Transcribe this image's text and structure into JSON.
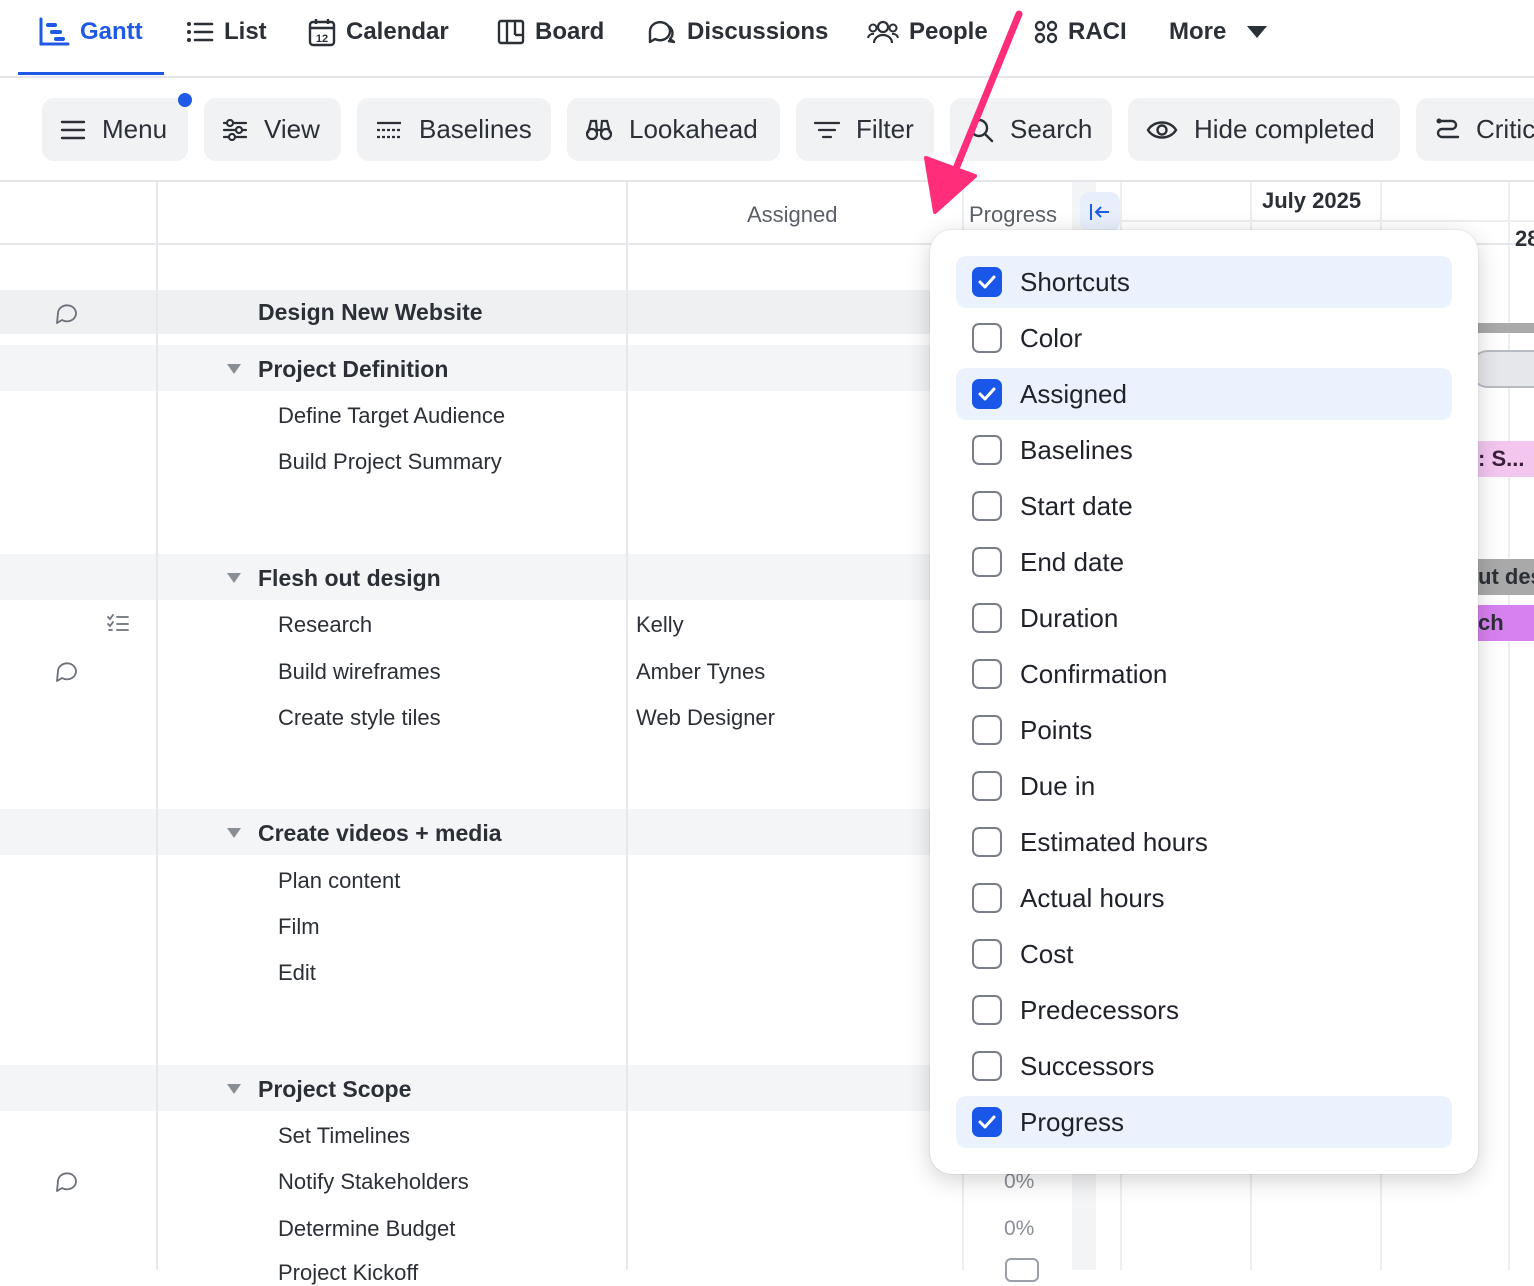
{
  "nav": {
    "tabs": [
      {
        "label": "Gantt",
        "icon": "gantt-icon",
        "active": true
      },
      {
        "label": "List",
        "icon": "list-icon"
      },
      {
        "label": "Calendar",
        "icon": "calendar-icon"
      },
      {
        "label": "Board",
        "icon": "board-icon"
      },
      {
        "label": "Discussions",
        "icon": "discussions-icon"
      },
      {
        "label": "People",
        "icon": "people-icon"
      },
      {
        "label": "RACI",
        "icon": "raci-icon"
      },
      {
        "label": "More",
        "icon": "chevron-down-icon"
      }
    ],
    "calendar_icon_day": "12",
    "accent": "#1f5ae6"
  },
  "toolbar": {
    "buttons": [
      {
        "label": "Menu",
        "icon": "menu-icon"
      },
      {
        "label": "View",
        "icon": "sliders-icon"
      },
      {
        "label": "Baselines",
        "icon": "baselines-icon"
      },
      {
        "label": "Lookahead",
        "icon": "binoculars-icon"
      },
      {
        "label": "Filter",
        "icon": "filter-icon"
      },
      {
        "label": "Search",
        "icon": "search-icon"
      },
      {
        "label": "Hide completed",
        "icon": "eye-icon"
      },
      {
        "label": "Critic",
        "icon": "critical-path-icon"
      }
    ]
  },
  "grid": {
    "headers": {
      "assigned": "Assigned",
      "progress": "Progress"
    },
    "project_title": "Design New Website",
    "groups": [
      {
        "title": "Project Definition",
        "tasks": [
          {
            "name": "Define Target Audience",
            "assigned": ""
          },
          {
            "name": "Build Project Summary",
            "assigned": ""
          }
        ]
      },
      {
        "title": "Flesh out design",
        "tasks": [
          {
            "name": "Research",
            "assigned": "Kelly"
          },
          {
            "name": "Build wireframes",
            "assigned": "Amber Tynes"
          },
          {
            "name": "Create style tiles",
            "assigned": "Web Designer"
          }
        ]
      },
      {
        "title": "Create videos + media",
        "tasks": [
          {
            "name": "Plan content",
            "assigned": ""
          },
          {
            "name": "Film",
            "assigned": ""
          },
          {
            "name": "Edit",
            "assigned": ""
          }
        ]
      },
      {
        "title": "Project Scope",
        "tasks": [
          {
            "name": "Set Timelines",
            "assigned": "",
            "progress": ""
          },
          {
            "name": "Notify Stakeholders",
            "assigned": "",
            "progress": "0%"
          },
          {
            "name": "Determine Budget",
            "assigned": "",
            "progress": "0%"
          },
          {
            "name": "Project Kickoff",
            "assigned": ""
          }
        ]
      }
    ]
  },
  "timeline": {
    "month": "July 2025",
    "day": "28",
    "bars": [
      {
        "text": ": S...",
        "color": "#f3c6f0",
        "text_color": "#3a1f3a"
      },
      {
        "text": "ut des",
        "color": "#a9a9a9",
        "text_color": "#2b2f36"
      },
      {
        "text": "ch",
        "color": "#d780f0",
        "text_color": "#2b2f36"
      }
    ]
  },
  "column_panel": {
    "options": [
      {
        "label": "Shortcuts",
        "checked": true
      },
      {
        "label": "Color",
        "checked": false
      },
      {
        "label": "Assigned",
        "checked": true
      },
      {
        "label": "Baselines",
        "checked": false
      },
      {
        "label": "Start date",
        "checked": false
      },
      {
        "label": "End date",
        "checked": false
      },
      {
        "label": "Duration",
        "checked": false
      },
      {
        "label": "Confirmation",
        "checked": false
      },
      {
        "label": "Points",
        "checked": false
      },
      {
        "label": "Due in",
        "checked": false
      },
      {
        "label": "Estimated hours",
        "checked": false
      },
      {
        "label": "Actual hours",
        "checked": false
      },
      {
        "label": "Cost",
        "checked": false
      },
      {
        "label": "Predecessors",
        "checked": false
      },
      {
        "label": "Successors",
        "checked": false
      },
      {
        "label": "Progress",
        "checked": true
      }
    ],
    "check_color": "#1a56e8"
  },
  "annotation": {
    "arrow_color": "#ff2d7a"
  }
}
